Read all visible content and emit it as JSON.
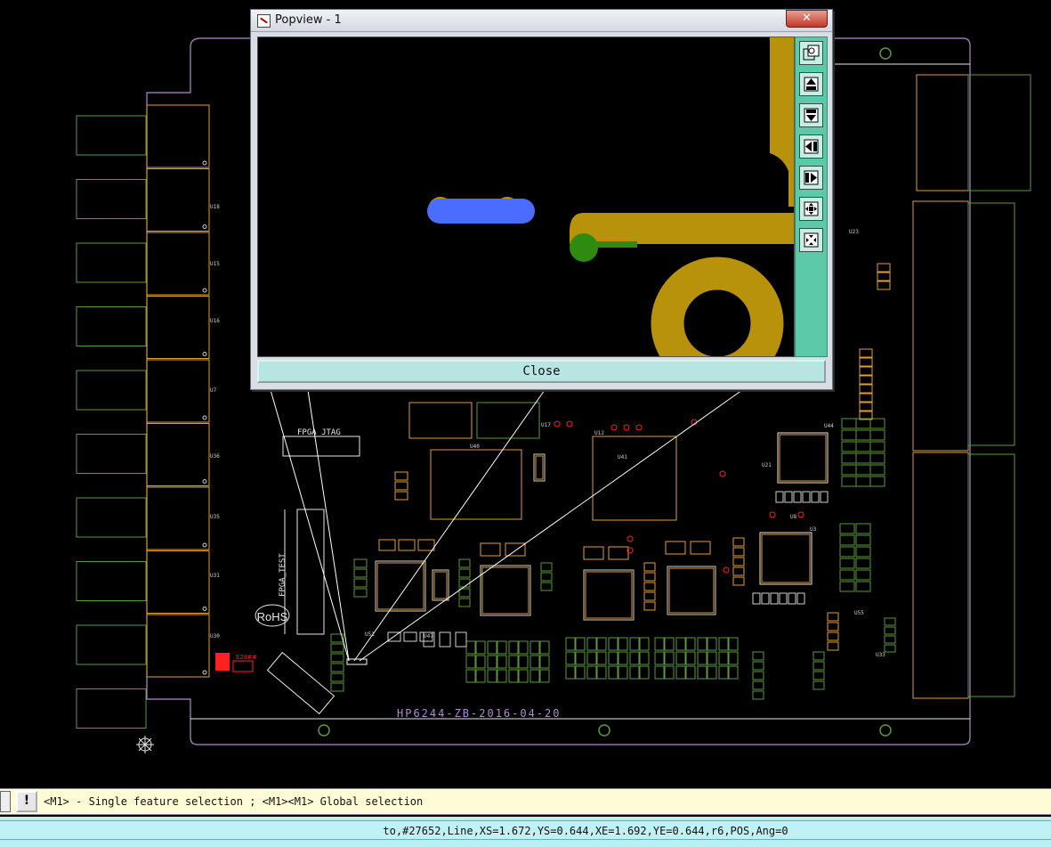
{
  "popview": {
    "title": "Popview - 1",
    "close_button": "Close",
    "tools": [
      {
        "name": "zoom-restore-icon"
      },
      {
        "name": "pan-up-icon"
      },
      {
        "name": "pan-down-icon"
      },
      {
        "name": "pan-left-icon"
      },
      {
        "name": "pan-right-icon"
      },
      {
        "name": "zoom-in-icon"
      },
      {
        "name": "zoom-out-icon"
      }
    ],
    "colors": {
      "copper": "#b8920a",
      "selected": "#4a6cff",
      "green_pad": "#2f8a10",
      "tool_panel": "#5cc9a9"
    }
  },
  "board": {
    "silkscreen_label": "HP6244-ZB-2016-04-20",
    "fpga_jtag": "FPGA_JTAG",
    "fpga_test": "FPGA_TEST",
    "rohs": "RoHS",
    "colors": {
      "outline": "#b48ad0",
      "part": "#e0a030",
      "silk": "#d0d0d0",
      "green": "#5a9a3a",
      "red": "#ff2020",
      "white": "#e8e8e8"
    },
    "component_labels": [
      "U18",
      "U15",
      "U16",
      "U7",
      "U36",
      "U35",
      "U31",
      "U30",
      "U40",
      "U17",
      "U41",
      "U12",
      "U23",
      "U44",
      "U21",
      "U8",
      "U3",
      "U55",
      "U33",
      "U51",
      "U47"
    ]
  },
  "message_bar": {
    "warning_icon": "!",
    "text": "<M1> - Single feature selection ; <M1><M1> Global selection"
  },
  "status_bar": {
    "text": "to,#27652,Line,XS=1.672,YS=0.644,XE=1.692,YE=0.644,r6,POS,Ang=0"
  }
}
